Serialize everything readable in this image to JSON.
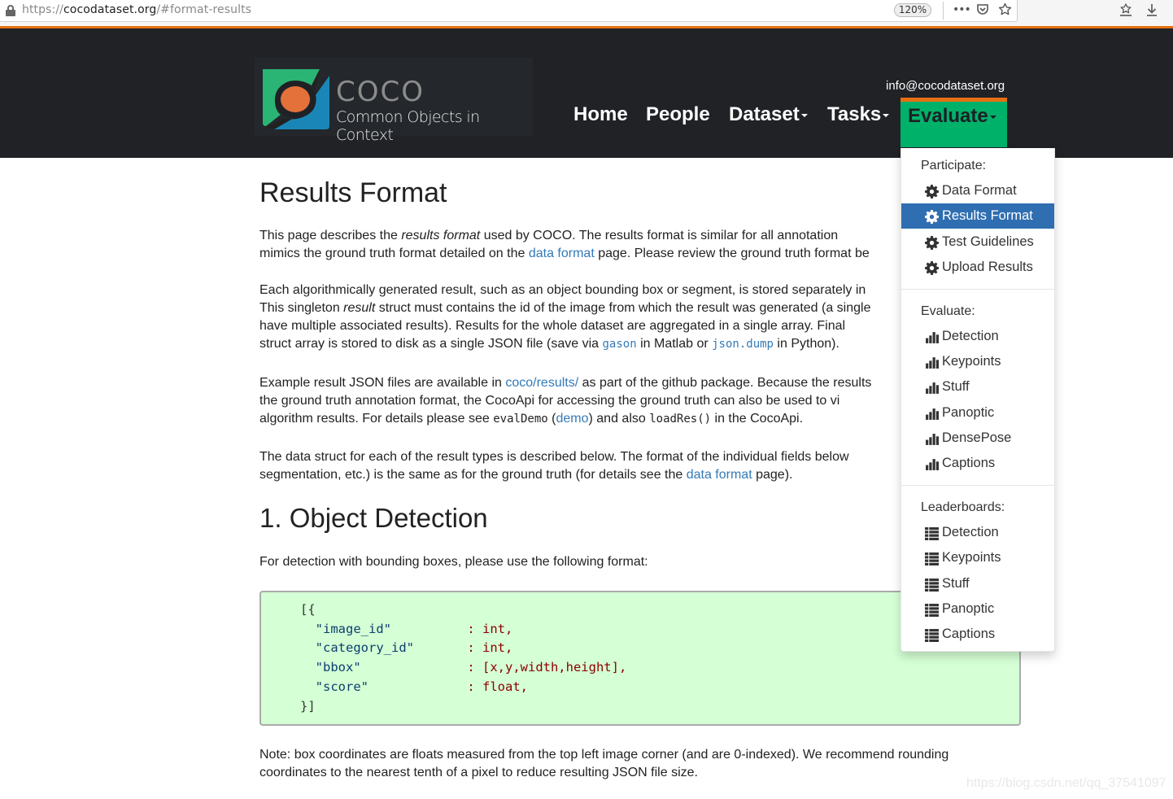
{
  "browser": {
    "url_scheme": "https://",
    "url_host": "cocodataset.org",
    "url_path": "/#format-results",
    "zoom": "120%",
    "icons": [
      "lock-icon",
      "more-actions-icon",
      "pocket-icon",
      "bookmark-star-icon",
      "library-icon",
      "download-icon"
    ]
  },
  "header": {
    "logo_title": "COCO",
    "logo_tagline": "Common Objects in Context",
    "email": "info@cocodataset.org",
    "nav": [
      {
        "label": "Home"
      },
      {
        "label": "People"
      },
      {
        "label": "Dataset",
        "dropdown": true
      },
      {
        "label": "Tasks",
        "dropdown": true
      },
      {
        "label": "Evaluate",
        "dropdown": true,
        "active": true
      }
    ],
    "colors": {
      "accent": "#00b16a",
      "orange": "#e57012",
      "dark": "#202226"
    }
  },
  "dropdown": {
    "sections": [
      {
        "header": "Participate:",
        "icon": "gear-icon",
        "items": [
          {
            "label": "Data Format"
          },
          {
            "label": "Results Format",
            "active": true
          },
          {
            "label": "Test Guidelines"
          },
          {
            "label": "Upload Results"
          }
        ]
      },
      {
        "header": "Evaluate:",
        "icon": "bar-chart-icon",
        "items": [
          {
            "label": "Detection"
          },
          {
            "label": "Keypoints"
          },
          {
            "label": "Stuff"
          },
          {
            "label": "Panoptic"
          },
          {
            "label": "DensePose"
          },
          {
            "label": "Captions"
          }
        ]
      },
      {
        "header": "Leaderboards:",
        "icon": "list-icon",
        "items": [
          {
            "label": "Detection"
          },
          {
            "label": "Keypoints"
          },
          {
            "label": "Stuff"
          },
          {
            "label": "Panoptic"
          },
          {
            "label": "Captions"
          }
        ]
      }
    ]
  },
  "content": {
    "title": "Results Format",
    "p1": {
      "a": "This page describes the ",
      "em": "results format",
      "b": " used by COCO. The results format is similar for all annotation",
      "c": "mimics the ground truth format detailed on the ",
      "link": "data format",
      "d": " page. Please review the ground truth format be"
    },
    "p2": {
      "a": "Each algorithmically generated result, such as an object bounding box or segment, is stored separately in",
      "b": "This singleton ",
      "em": "result",
      "c": " struct must contains the id of the image from which the result was generated (a single",
      "d": "have multiple associated results). Results for the whole dataset are aggregated in a single array. Final",
      "e": "struct array is stored to disk as a single JSON file (save via ",
      "code1": "gason",
      "f": " in Matlab or ",
      "code2": "json.dump",
      "g": " in Python)."
    },
    "p3": {
      "a": "Example result JSON files are available in ",
      "link1": "coco/results/",
      "b": " as part of the github package. Because the results",
      "c": "the ground truth annotation format, the CocoApi for accessing the ground truth can also be used to vi",
      "d": "algorithm results. For details please see ",
      "code1": "evalDemo",
      "e": " (",
      "link2": "demo",
      "f": ") and also ",
      "code2": "loadRes()",
      "g": " in the CocoApi."
    },
    "p4": {
      "a": "The data struct for each of the result types is described below. The format of the individual fields below",
      "b": "segmentation, etc.) is the same as for the ground truth (for details see the ",
      "link": "data format",
      "c": " page)."
    },
    "section1_title": "1. Object Detection",
    "section1_intro": "For detection with bounding boxes, please use the following format:",
    "code_block": {
      "open": "[{",
      "fields": [
        {
          "key": "\"image_id\"",
          "value": ": int,"
        },
        {
          "key": "\"category_id\"",
          "value": ": int,"
        },
        {
          "key": "\"bbox\"",
          "value": ": [x,y,width,height],"
        },
        {
          "key": "\"score\"",
          "value": ": float,"
        }
      ],
      "close": "}]"
    },
    "note_line1": "Note: box coordinates are floats measured from the top left image corner (and are 0-indexed). We recommend rounding",
    "note_line2": "coordinates to the nearest tenth of a pixel to reduce resulting JSON file size."
  },
  "watermark": "https://blog.csdn.net/qq_37541097"
}
